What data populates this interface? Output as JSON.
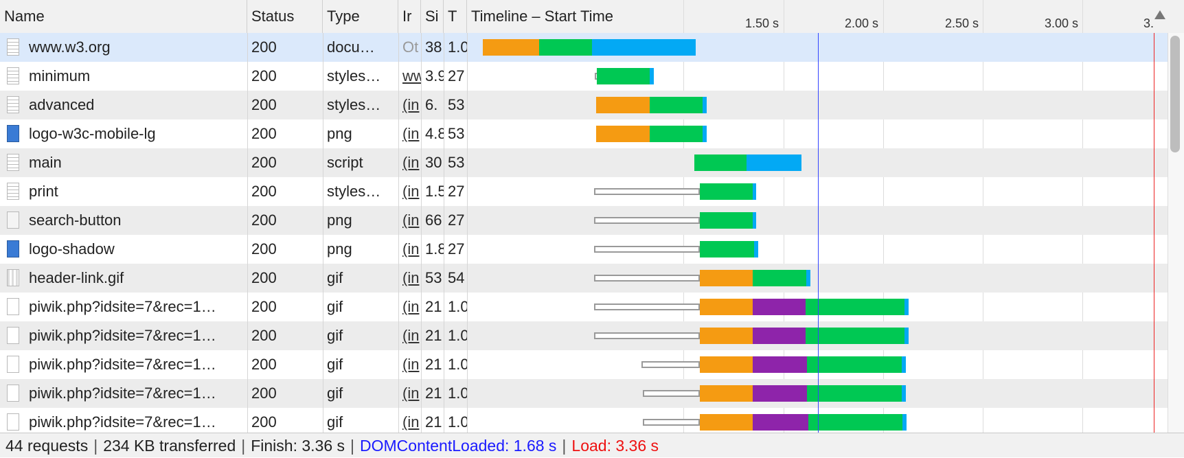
{
  "columns": {
    "name": "Name",
    "status": "Status",
    "type": "Type",
    "initiator": "Ir",
    "size": "Si",
    "time": "T",
    "timeline": "Timeline – Start Time"
  },
  "timeline_ticks": [
    "1.50 s",
    "2.00 s",
    "2.50 s",
    "3.00 s",
    "3."
  ],
  "rows": [
    {
      "name": "www.w3.org",
      "status": "200",
      "type": "docu…",
      "initiator": "Ot",
      "size": "38",
      "time": "1.0",
      "icon": "document-icon"
    },
    {
      "name": "minimum",
      "status": "200",
      "type": "styles…",
      "initiator": "ww",
      "size": "3.9",
      "time": "27",
      "icon": "stylesheet-icon"
    },
    {
      "name": "advanced",
      "status": "200",
      "type": "styles…",
      "initiator": "(in",
      "size": "6.",
      "time": "53",
      "icon": "stylesheet-icon"
    },
    {
      "name": "logo-w3c-mobile-lg",
      "status": "200",
      "type": "png",
      "initiator": "(in",
      "size": "4.8",
      "time": "53",
      "icon": "image-icon"
    },
    {
      "name": "main",
      "status": "200",
      "type": "script",
      "initiator": "(in",
      "size": "30",
      "time": "53",
      "icon": "script-icon"
    },
    {
      "name": "print",
      "status": "200",
      "type": "styles…",
      "initiator": "(in",
      "size": "1.5",
      "time": "27",
      "icon": "stylesheet-icon"
    },
    {
      "name": "search-button",
      "status": "200",
      "type": "png",
      "initiator": "(in",
      "size": "66",
      "time": "27",
      "icon": "search-image-icon"
    },
    {
      "name": "logo-shadow",
      "status": "200",
      "type": "png",
      "initiator": "(in",
      "size": "1.8",
      "time": "27",
      "icon": "image-icon"
    },
    {
      "name": "header-link.gif",
      "status": "200",
      "type": "gif",
      "initiator": "(in",
      "size": "53",
      "time": "54",
      "icon": "gif-icon"
    },
    {
      "name": "piwik.php?idsite=7&rec=1…",
      "status": "200",
      "type": "gif",
      "initiator": "(in",
      "size": "21",
      "time": "1.0",
      "icon": "blank-file-icon"
    },
    {
      "name": "piwik.php?idsite=7&rec=1…",
      "status": "200",
      "type": "gif",
      "initiator": "(in",
      "size": "21",
      "time": "1.0",
      "icon": "blank-file-icon"
    },
    {
      "name": "piwik.php?idsite=7&rec=1…",
      "status": "200",
      "type": "gif",
      "initiator": "(in",
      "size": "21",
      "time": "1.0",
      "icon": "blank-file-icon"
    },
    {
      "name": "piwik.php?idsite=7&rec=1…",
      "status": "200",
      "type": "gif",
      "initiator": "(in",
      "size": "21",
      "time": "1.0",
      "icon": "blank-file-icon"
    },
    {
      "name": "piwik.php?idsite=7&rec=1…",
      "status": "200",
      "type": "gif",
      "initiator": "(in",
      "size": "21",
      "time": "1.0",
      "icon": "blank-file-icon"
    }
  ],
  "footer": {
    "requests": "44 requests",
    "transferred": "234 KB transferred",
    "finish": "Finish: 3.36 s",
    "dom": "DOMContentLoaded: 1.68 s",
    "load": "Load: 3.36 s"
  },
  "colors": {
    "blocking": "#999999",
    "dns": "#8e24aa",
    "connect": "#f59b12",
    "waiting": "#00c853",
    "download": "#03a9f4",
    "dom_line": "#3344ff",
    "load_line": "#ee2222",
    "dom_text": "#1a1aff",
    "load_text": "#ee1111"
  }
}
